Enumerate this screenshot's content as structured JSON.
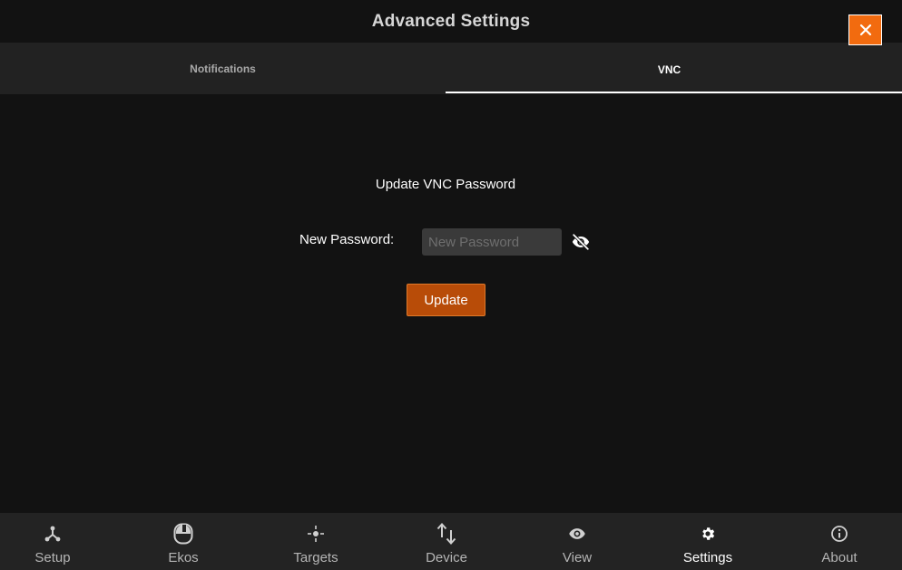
{
  "header": {
    "title": "Advanced Settings"
  },
  "tabs": [
    {
      "label": "Notifications",
      "selected": false
    },
    {
      "label": "VNC",
      "selected": true
    }
  ],
  "close_icon": "close-icon",
  "vnc": {
    "heading": "Update VNC Password",
    "password_label": "New Password:",
    "password_value": "",
    "password_placeholder": "New Password",
    "visibility_icon": "eye-off-icon",
    "update_label": "Update"
  },
  "bottom_nav": {
    "items": [
      {
        "label": "Setup",
        "icon": "hub-icon",
        "active": false
      },
      {
        "label": "Ekos",
        "icon": "telescope-dome-icon",
        "active": false
      },
      {
        "label": "Targets",
        "icon": "crosshair-icon",
        "active": false
      },
      {
        "label": "Device",
        "icon": "swap-vertical-icon",
        "active": false
      },
      {
        "label": "View",
        "icon": "eye-icon",
        "active": false
      },
      {
        "label": "Settings",
        "icon": "gear-icon",
        "active": true
      },
      {
        "label": "About",
        "icon": "info-icon",
        "active": false
      }
    ]
  },
  "colors": {
    "accent": "#f26b0f",
    "button": "#b84c08",
    "background": "#121212",
    "bar": "#232323"
  }
}
